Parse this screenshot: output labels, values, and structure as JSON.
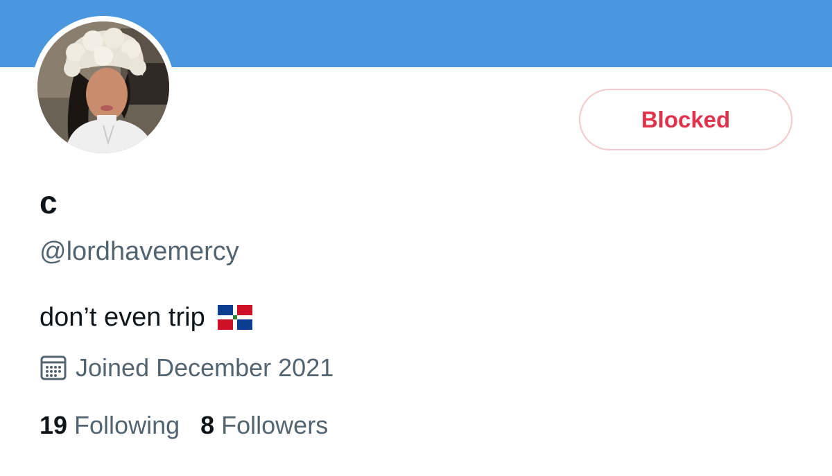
{
  "profile": {
    "display_name": "c",
    "handle": "@lordhavemercy",
    "bio": "don’t even trip",
    "bio_emoji": "dominican-republic-flag",
    "joined": "Joined December 2021",
    "following_count": "19",
    "following_label": "Following",
    "followers_count": "8",
    "followers_label": "Followers"
  },
  "actions": {
    "blocked_label": "Blocked"
  },
  "icons": {
    "joined": "calendar-icon"
  },
  "colors": {
    "banner": "#4a97e0",
    "blocked_text": "#e0324a",
    "blocked_border": "#f2c9cc",
    "secondary_text": "#536471",
    "primary_text": "#0f1419"
  }
}
